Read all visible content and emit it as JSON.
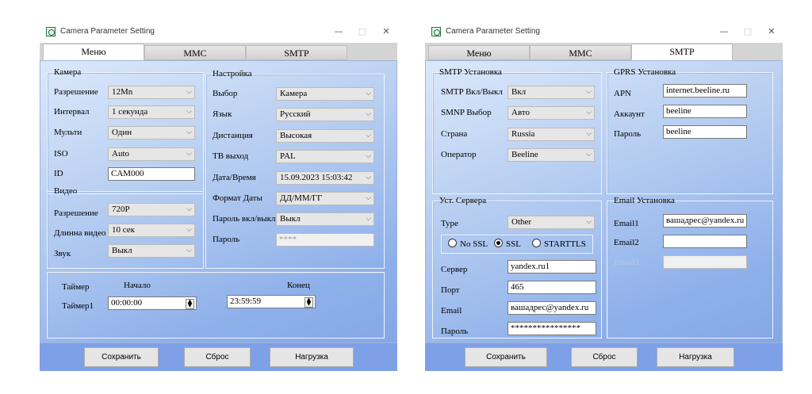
{
  "window_title": "Camera Parameter Setting",
  "tabs": [
    "Меню",
    "MMC",
    "SMTP"
  ],
  "buttons": {
    "save": "Сохранить",
    "reset": "Сброс",
    "load": "Нагрузка"
  },
  "titlebar": {
    "min": "—",
    "max": "□",
    "close": "✕"
  },
  "menu": {
    "camera_title": "Камера",
    "camera": [
      {
        "label": "Разрешение",
        "value": "12Mn"
      },
      {
        "label": "Интервал",
        "value": "1 секунда"
      },
      {
        "label": "Мульти",
        "value": "Один"
      },
      {
        "label": "ISO",
        "value": "Auto"
      }
    ],
    "id_label": "ID",
    "id_value": "CAM000",
    "video_title": "Видео",
    "video": [
      {
        "label": "Разрешение",
        "value": "720P"
      },
      {
        "label": "Длинна видео",
        "value": "10 сек"
      },
      {
        "label": "Звук",
        "value": "Выкл"
      }
    ],
    "settings_title": "Настройка",
    "settings": [
      {
        "label": "Выбор",
        "value": "Камера"
      },
      {
        "label": "Язык",
        "value": "Русский"
      },
      {
        "label": "Дистанция",
        "value": "Высокая"
      },
      {
        "label": "TB выход",
        "value": "PAL"
      },
      {
        "label": "Дата/Время",
        "value": "15.09.2023 15:03:42"
      },
      {
        "label": "Формат Даты",
        "value": "ДД/ММ/ГГ"
      },
      {
        "label": "Пароль вкл/выкл",
        "value": "Выкл"
      }
    ],
    "password_label": "Пароль",
    "password_value": "****",
    "timer_label": "Таймер",
    "start_label": "Начало",
    "end_label": "Конец",
    "timer1_label": "Таймер1",
    "timer_start": "00:00:00",
    "timer_end": "23:59:59"
  },
  "smtp": {
    "smtp_setup_title": "SMTP Установка",
    "smtp_setup": [
      {
        "label": "SMTP Вкл/Выкл",
        "value": "Вкл"
      },
      {
        "label": "SMNP Выбор",
        "value": "Авто"
      },
      {
        "label": "Страна",
        "value": "Russia"
      },
      {
        "label": "Оператор",
        "value": "Beeline"
      }
    ],
    "gprs_title": "GPRS Установка",
    "gprs": [
      {
        "label": "APN",
        "value": "internet.beeline.ru"
      },
      {
        "label": "Аккаунт",
        "value": "beeline"
      },
      {
        "label": "Пароль",
        "value": "beeline"
      }
    ],
    "server_title": "Уст. Сервера",
    "type_label": "Type",
    "type_value": "Other",
    "radios": [
      {
        "label": "No SSL",
        "selected": false
      },
      {
        "label": "SSL",
        "selected": true
      },
      {
        "label": "STARTTLS",
        "selected": false
      }
    ],
    "server_fields": [
      {
        "label": "Сервер",
        "value": "yandex.ru1"
      },
      {
        "label": "Порт",
        "value": "465"
      },
      {
        "label": "Email",
        "value": "вашадрес@yandex.ru"
      },
      {
        "label": "Пароль",
        "value": "****************"
      }
    ],
    "email_title": "Email Установка",
    "emails": [
      {
        "label": "Email1",
        "value": "вашадрес@yandex.ru"
      },
      {
        "label": "Email2",
        "value": ""
      },
      {
        "label": "Email3",
        "value": ""
      }
    ]
  }
}
